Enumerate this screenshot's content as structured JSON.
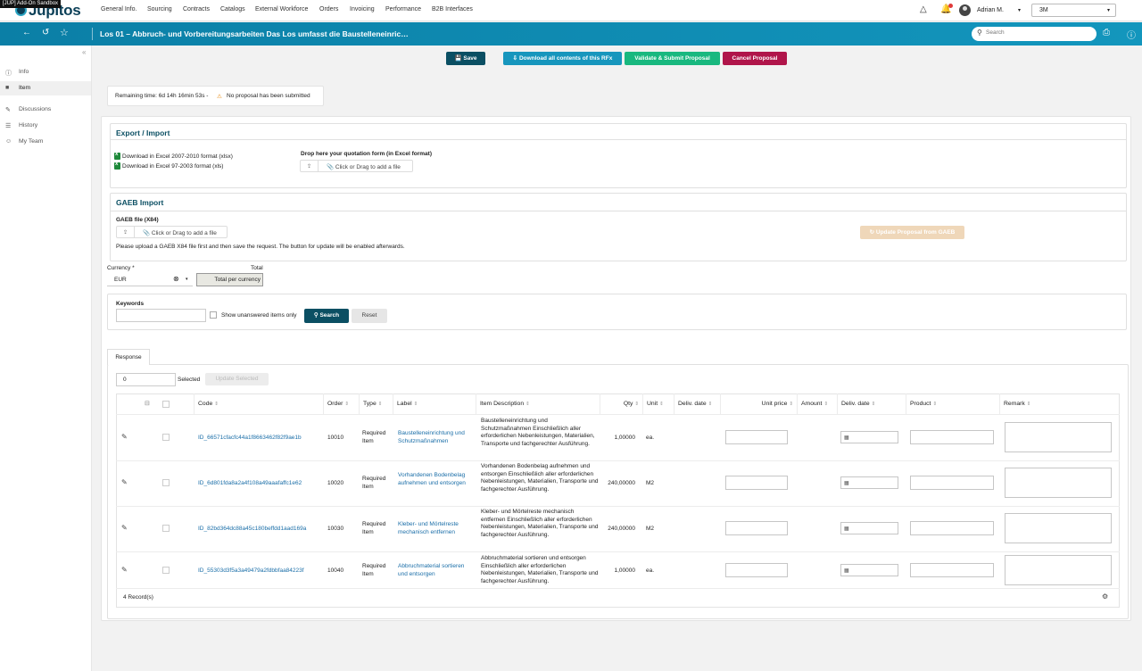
{
  "topnav": {
    "sandbox_badge": "[JUP] Add-On Sandbox",
    "logo_text": "Jupitos",
    "menu": [
      "General Info.",
      "Sourcing",
      "Contracts",
      "Catalogs",
      "External Workforce",
      "Orders",
      "Invoicing",
      "Performance",
      "B2B Interfaces"
    ],
    "user_name": "Adrian M.",
    "company": "3M",
    "icons": {
      "alert": "warning-triangle-icon",
      "bell": "bell-icon",
      "avatar": "user-avatar-icon"
    }
  },
  "titlebar": {
    "title": "Los 01 – Abbruch- und Vorbereitungsarbeiten Das Los umfasst die Baustelleneinric…",
    "search_placeholder": "Search"
  },
  "sidebar": {
    "items": [
      {
        "label": "Info",
        "icon": "info-icon"
      },
      {
        "label": "Item",
        "icon": "item-icon",
        "active": true
      },
      {
        "label": "Discussions",
        "icon": "discussions-icon"
      },
      {
        "label": "History",
        "icon": "history-icon"
      },
      {
        "label": "My Team",
        "icon": "team-icon"
      }
    ]
  },
  "actions": {
    "save": "Save",
    "download": "Download all contents of this RFx",
    "validate": "Validate & Submit Proposal",
    "cancel": "Cancel Proposal"
  },
  "remaining": {
    "time": "Remaining time:  6d 14h 16min 53s -",
    "status": "No proposal has been submitted"
  },
  "export_import": {
    "title": "Export / Import",
    "download_xlsx": "Download in Excel 2007-2010 format (xlsx)",
    "download_xls": "Download in Excel 97-2003 format (xls)",
    "drop_label": "Drop here your quotation form (in Excel format)",
    "drop_button": "Click or Drag to add a file"
  },
  "gaeb": {
    "title": "GAEB Import",
    "file_label": "GAEB file (X84)",
    "drop_button": "Click or Drag to add a file",
    "hint": "Please upload a GAEB X84 file first and then save the request. The button for update will be enabled afterwards.",
    "update_button": "Update Proposal from GAEB"
  },
  "currency": {
    "label": "Currency *",
    "value": "EUR",
    "total_label": "Total",
    "total_button": "Total per currency"
  },
  "filter": {
    "keywords_label": "Keywords",
    "unanswered_label": "Show unanswered items only",
    "search_button": "Search",
    "reset_button": "Reset"
  },
  "response": {
    "tab": "Response",
    "selected_count": "0",
    "selected_label": "Selected",
    "update_selected": "Update Selected",
    "columns": [
      "Code",
      "Order",
      "Type",
      "Label",
      "Item Description",
      "Qty",
      "Unit",
      "Deliv. date",
      "Unit price",
      "Amount",
      "Deliv. date",
      "Product",
      "Remark"
    ],
    "rows": [
      {
        "code": "ID_66571cfacfc44a1f8663462f82f9ae1b",
        "order": "10010",
        "type": "Required Item",
        "label": "Baustelleneinrichtung und Schutzmaßnahmen",
        "description": "Baustelleneinrichtung und Schutzmaßnahmen Einschließlich aller erforderlichen Nebenleistungen, Materialien, Transporte und fachgerechter Ausführung.",
        "qty": "1,00000",
        "unit": "ea."
      },
      {
        "code": "ID_6d801fda8a2a4f108a49aaafaffc1e62",
        "order": "10020",
        "type": "Required Item",
        "label": "Vorhandenen Bodenbelag aufnehmen und entsorgen",
        "description": "Vorhandenen Bodenbelag aufnehmen und entsorgen Einschließlich aller erforderlichen Nebenleistungen, Materialien, Transporte und fachgerechter Ausführung.",
        "qty": "240,00000",
        "unit": "M2"
      },
      {
        "code": "ID_82bd364dc88a45c180beffdd1aad169a",
        "order": "10030",
        "type": "Required Item",
        "label": "Kleber- und Mörtelreste mechanisch entfernen",
        "description": "Kleber- und Mörtelreste mechanisch entfernen Einschließlich aller erforderlichen Nebenleistungen, Materialien, Transporte und fachgerechter Ausführung.",
        "qty": "240,00000",
        "unit": "M2"
      },
      {
        "code": "ID_55303d3f5a3a49479a2fdbbfaa84223f",
        "order": "10040",
        "type": "Required Item",
        "label": "Abbruchmaterial sortieren und entsorgen",
        "description": "Abbruchmaterial sortieren und entsorgen Einschließlich aller erforderlichen Nebenleistungen, Materialien, Transporte und fachgerechter Ausführung.",
        "qty": "1,00000",
        "unit": "ea."
      }
    ],
    "records": "4 Record(s)"
  },
  "colors": {
    "brand": "#0b7fa6",
    "dark": "#0b4f63",
    "success": "#19b87f",
    "danger": "#b0154a",
    "link": "#1a6ea8"
  }
}
